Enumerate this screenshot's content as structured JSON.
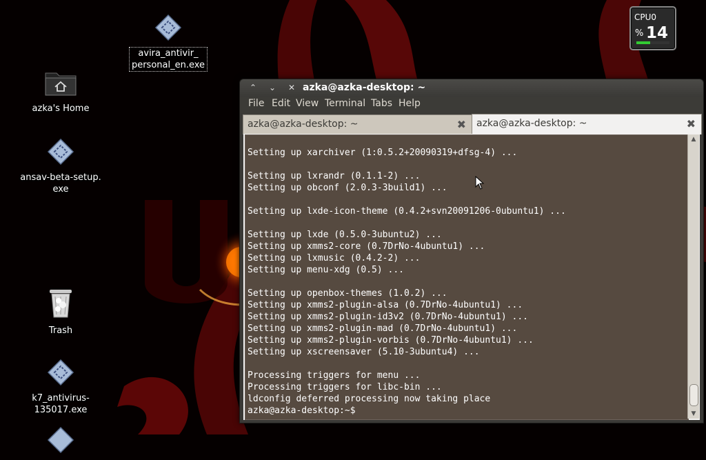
{
  "desktop": {
    "icons": [
      {
        "label": "avira_antivir_\npersonal_en.exe",
        "line1": "avira_antivir_",
        "line2": "personal_en.exe",
        "icon": "exe-icon"
      },
      {
        "label": "azka's Home",
        "icon": "home-folder-icon"
      },
      {
        "line1": "ansav-beta-setup.",
        "line2": "exe",
        "icon": "exe-icon"
      },
      {
        "label": "Trash",
        "icon": "trash-icon"
      },
      {
        "line1": "k7_antivirus-",
        "line2": "135017.exe",
        "icon": "exe-icon"
      }
    ]
  },
  "cpu_widget": {
    "label": "CPU0",
    "percent_sign": "%",
    "value": "14",
    "usage_percent": 14
  },
  "terminal": {
    "title": "azka@azka-desktop: ~",
    "menu": [
      "File",
      "Edit",
      "View",
      "Terminal",
      "Tabs",
      "Help"
    ],
    "tabs": [
      {
        "label": "azka@azka-desktop: ~",
        "active": false
      },
      {
        "label": "azka@azka-desktop: ~",
        "active": true
      }
    ],
    "lines": [
      "Setting up xarchiver (1:0.5.2+20090319+dfsg-4) ...",
      "",
      "Setting up lxrandr (0.1.1-2) ...",
      "Setting up obconf (2.0.3-3build1) ...",
      "",
      "Setting up lxde-icon-theme (0.4.2+svn20091206-0ubuntu1) ...",
      "",
      "Setting up lxde (0.5.0-3ubuntu2) ...",
      "Setting up xmms2-core (0.7DrNo-4ubuntu1) ...",
      "Setting up lxmusic (0.4.2-2) ...",
      "Setting up menu-xdg (0.5) ...",
      "",
      "Setting up openbox-themes (1.0.2) ...",
      "Setting up xmms2-plugin-alsa (0.7DrNo-4ubuntu1) ...",
      "Setting up xmms2-plugin-id3v2 (0.7DrNo-4ubuntu1) ...",
      "Setting up xmms2-plugin-mad (0.7DrNo-4ubuntu1) ...",
      "Setting up xmms2-plugin-vorbis (0.7DrNo-4ubuntu1) ...",
      "Setting up xscreensaver (5.10-3ubuntu4) ...",
      "",
      "Processing triggers for menu ...",
      "Processing triggers for libc-bin ...",
      "ldconfig deferred processing now taking place",
      "azka@azka-desktop:~$"
    ]
  },
  "colors": {
    "console_bg": "#564a40",
    "wallpaper_accent": "#b01010"
  }
}
